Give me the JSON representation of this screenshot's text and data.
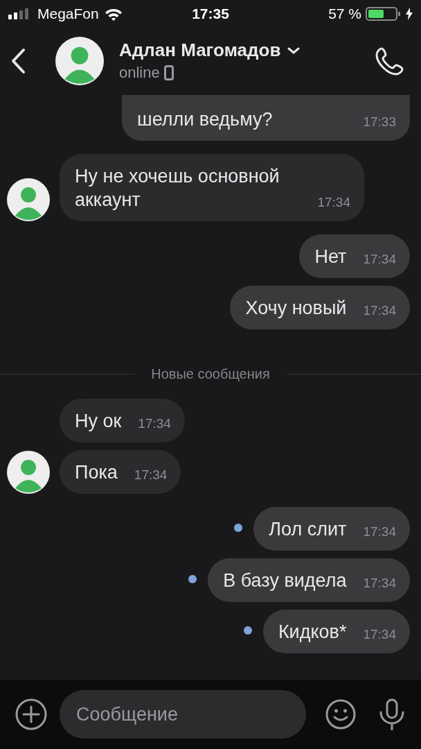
{
  "status_bar": {
    "carrier": "MegaFon",
    "time": "17:35",
    "battery": "57 %"
  },
  "header": {
    "name": "Адлан Магомадов",
    "status": "online"
  },
  "messages": [
    {
      "kind": "message",
      "text": "шелли ведьму?",
      "time": "17:33",
      "outgoing": true,
      "cut_off": true,
      "unread": false,
      "avatar": false
    },
    {
      "kind": "message",
      "text": "Ну не хочешь основной аккаунт",
      "time": "17:34",
      "outgoing": false,
      "cut_off": false,
      "unread": false,
      "avatar": true
    },
    {
      "kind": "message",
      "text": "Нет",
      "time": "17:34",
      "outgoing": true,
      "cut_off": false,
      "unread": false,
      "avatar": false
    },
    {
      "kind": "message",
      "text": "Хочу новый",
      "time": "17:34",
      "outgoing": true,
      "cut_off": false,
      "unread": false,
      "avatar": false
    },
    {
      "kind": "divider",
      "text": "Новые сообщения"
    },
    {
      "kind": "message",
      "text": "Ну ок",
      "time": "17:34",
      "outgoing": false,
      "cut_off": false,
      "unread": false,
      "avatar": false
    },
    {
      "kind": "message",
      "text": "Пока",
      "time": "17:34",
      "outgoing": false,
      "cut_off": false,
      "unread": false,
      "avatar": true
    },
    {
      "kind": "message",
      "text": "Лол слит",
      "time": "17:34",
      "outgoing": true,
      "cut_off": false,
      "unread": true,
      "avatar": false
    },
    {
      "kind": "message",
      "text": "В базу видела",
      "time": "17:34",
      "outgoing": true,
      "cut_off": false,
      "unread": true,
      "avatar": false
    },
    {
      "kind": "message",
      "text": "Кидков*",
      "time": "17:34",
      "outgoing": true,
      "cut_off": false,
      "unread": true,
      "avatar": false
    }
  ],
  "composer": {
    "placeholder": "Сообщение"
  }
}
